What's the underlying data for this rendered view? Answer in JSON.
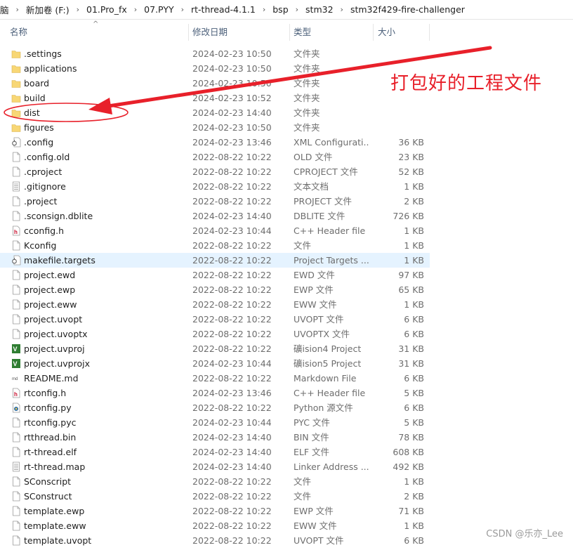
{
  "breadcrumb": [
    {
      "label": "脑"
    },
    {
      "label": "新加卷 (F:)"
    },
    {
      "label": "01.Pro_fx"
    },
    {
      "label": "07.PYY"
    },
    {
      "label": "rt-thread-4.1.1"
    },
    {
      "label": "bsp"
    },
    {
      "label": "stm32"
    },
    {
      "label": "stm32f429-fire-challenger"
    }
  ],
  "breadcrumb_sep": "›",
  "header": {
    "name": "名称",
    "date": "修改日期",
    "type": "类型",
    "size": "大小",
    "sort_arrow": "^"
  },
  "files": [
    {
      "name": ".settings",
      "date": "2024-02-23 10:50",
      "type": "文件夹",
      "size": "",
      "icon": "folder-icon"
    },
    {
      "name": "applications",
      "date": "2024-02-23 10:50",
      "type": "文件夹",
      "size": "",
      "icon": "folder-icon"
    },
    {
      "name": "board",
      "date": "2024-02-23 10:50",
      "type": "文件夹",
      "size": "",
      "icon": "folder-icon"
    },
    {
      "name": "build",
      "date": "2024-02-23 10:52",
      "type": "文件夹",
      "size": "",
      "icon": "folder-icon"
    },
    {
      "name": "dist",
      "date": "2024-02-23 14:40",
      "type": "文件夹",
      "size": "",
      "icon": "folder-icon"
    },
    {
      "name": "figures",
      "date": "2024-02-23 10:50",
      "type": "文件夹",
      "size": "",
      "icon": "folder-icon"
    },
    {
      "name": ".config",
      "date": "2024-02-23 13:46",
      "type": "XML Configurati...",
      "size": "36 KB",
      "icon": "config-file-icon"
    },
    {
      "name": ".config.old",
      "date": "2022-08-22 10:22",
      "type": "OLD 文件",
      "size": "23 KB",
      "icon": "file-icon"
    },
    {
      "name": ".cproject",
      "date": "2022-08-22 10:22",
      "type": "CPROJECT 文件",
      "size": "52 KB",
      "icon": "file-icon"
    },
    {
      "name": ".gitignore",
      "date": "2022-08-22 10:22",
      "type": "文本文档",
      "size": "1 KB",
      "icon": "text-file-icon"
    },
    {
      "name": ".project",
      "date": "2022-08-22 10:22",
      "type": "PROJECT 文件",
      "size": "2 KB",
      "icon": "file-icon"
    },
    {
      "name": ".sconsign.dblite",
      "date": "2024-02-23 14:40",
      "type": "DBLITE 文件",
      "size": "726 KB",
      "icon": "file-icon"
    },
    {
      "name": "cconfig.h",
      "date": "2024-02-23 10:44",
      "type": "C++ Header file",
      "size": "1 KB",
      "icon": "header-file-icon"
    },
    {
      "name": "Kconfig",
      "date": "2022-08-22 10:22",
      "type": "文件",
      "size": "1 KB",
      "icon": "file-icon"
    },
    {
      "name": "makefile.targets",
      "date": "2022-08-22 10:22",
      "type": "Project Targets ...",
      "size": "1 KB",
      "icon": "config-file-icon"
    },
    {
      "name": "project.ewd",
      "date": "2022-08-22 10:22",
      "type": "EWD 文件",
      "size": "97 KB",
      "icon": "file-icon"
    },
    {
      "name": "project.ewp",
      "date": "2022-08-22 10:22",
      "type": "EWP 文件",
      "size": "65 KB",
      "icon": "file-icon"
    },
    {
      "name": "project.eww",
      "date": "2022-08-22 10:22",
      "type": "EWW 文件",
      "size": "1 KB",
      "icon": "file-icon"
    },
    {
      "name": "project.uvopt",
      "date": "2022-08-22 10:22",
      "type": "UVOPT 文件",
      "size": "6 KB",
      "icon": "file-icon"
    },
    {
      "name": "project.uvoptx",
      "date": "2022-08-22 10:22",
      "type": "UVOPTX 文件",
      "size": "6 KB",
      "icon": "file-icon"
    },
    {
      "name": "project.uvproj",
      "date": "2022-08-22 10:22",
      "type": "礦ision4 Project",
      "size": "31 KB",
      "icon": "keil-project-icon"
    },
    {
      "name": "project.uvprojx",
      "date": "2024-02-23 10:44",
      "type": "礦ision5 Project",
      "size": "31 KB",
      "icon": "keil-project-icon"
    },
    {
      "name": "README.md",
      "date": "2022-08-22 10:22",
      "type": "Markdown File",
      "size": "6 KB",
      "icon": "markdown-file-icon"
    },
    {
      "name": "rtconfig.h",
      "date": "2024-02-23 13:46",
      "type": "C++ Header file",
      "size": "5 KB",
      "icon": "header-file-icon"
    },
    {
      "name": "rtconfig.py",
      "date": "2022-08-22 10:22",
      "type": "Python 源文件",
      "size": "6 KB",
      "icon": "python-file-icon"
    },
    {
      "name": "rtconfig.pyc",
      "date": "2024-02-23 10:44",
      "type": "PYC 文件",
      "size": "5 KB",
      "icon": "file-icon"
    },
    {
      "name": "rtthread.bin",
      "date": "2024-02-23 14:40",
      "type": "BIN 文件",
      "size": "78 KB",
      "icon": "file-icon"
    },
    {
      "name": "rt-thread.elf",
      "date": "2024-02-23 14:40",
      "type": "ELF 文件",
      "size": "608 KB",
      "icon": "file-icon"
    },
    {
      "name": "rt-thread.map",
      "date": "2024-02-23 14:40",
      "type": "Linker Address ...",
      "size": "492 KB",
      "icon": "text-file-icon"
    },
    {
      "name": "SConscript",
      "date": "2022-08-22 10:22",
      "type": "文件",
      "size": "1 KB",
      "icon": "file-icon"
    },
    {
      "name": "SConstruct",
      "date": "2022-08-22 10:22",
      "type": "文件",
      "size": "2 KB",
      "icon": "file-icon"
    },
    {
      "name": "template.ewp",
      "date": "2022-08-22 10:22",
      "type": "EWP 文件",
      "size": "71 KB",
      "icon": "file-icon"
    },
    {
      "name": "template.eww",
      "date": "2022-08-22 10:22",
      "type": "EWW 文件",
      "size": "1 KB",
      "icon": "file-icon"
    },
    {
      "name": "template.uvopt",
      "date": "2022-08-22 10:22",
      "type": "UVOPT 文件",
      "size": "6 KB",
      "icon": "file-icon"
    }
  ],
  "selected_file": "makefile.targets",
  "annotation": {
    "text": "打包好的工程文件",
    "color": "#e8202a",
    "target": "dist"
  },
  "watermark": "CSDN @乐亦_Lee",
  "colors": {
    "folder": "#f8d775",
    "selected_row": "#e5f3ff",
    "header_text": "#4c607a"
  }
}
